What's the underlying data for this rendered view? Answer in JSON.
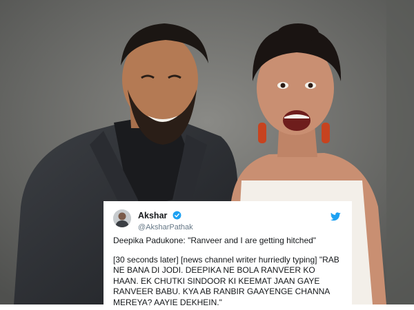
{
  "tweet": {
    "display_name": "Akshar",
    "handle": "@AksharPathak",
    "paragraph_1": "Deepika Padukone: \"Ranveer and I are getting hitched\"",
    "paragraph_2": "[30 seconds later] [news channel writer hurriedly typing] \"RAB NE BANA DI JODI. DEEPIKA NE BOLA RANVEER KO HAAN. EK CHUTKI SINDOOR KI KEEMAT JAAN GAYE RANVEER BABU. KYA AB RANBIR GAAYENGE CHANNA MEREYA? AAYIE DEKHEIN.\""
  },
  "icons": {
    "verified": "verified-badge-icon",
    "brand": "twitter-bird-icon"
  },
  "colors": {
    "twitter_blue": "#1da1f2",
    "text_primary": "#14171a",
    "text_secondary": "#657786",
    "background_wall": "#6f6f6c"
  }
}
